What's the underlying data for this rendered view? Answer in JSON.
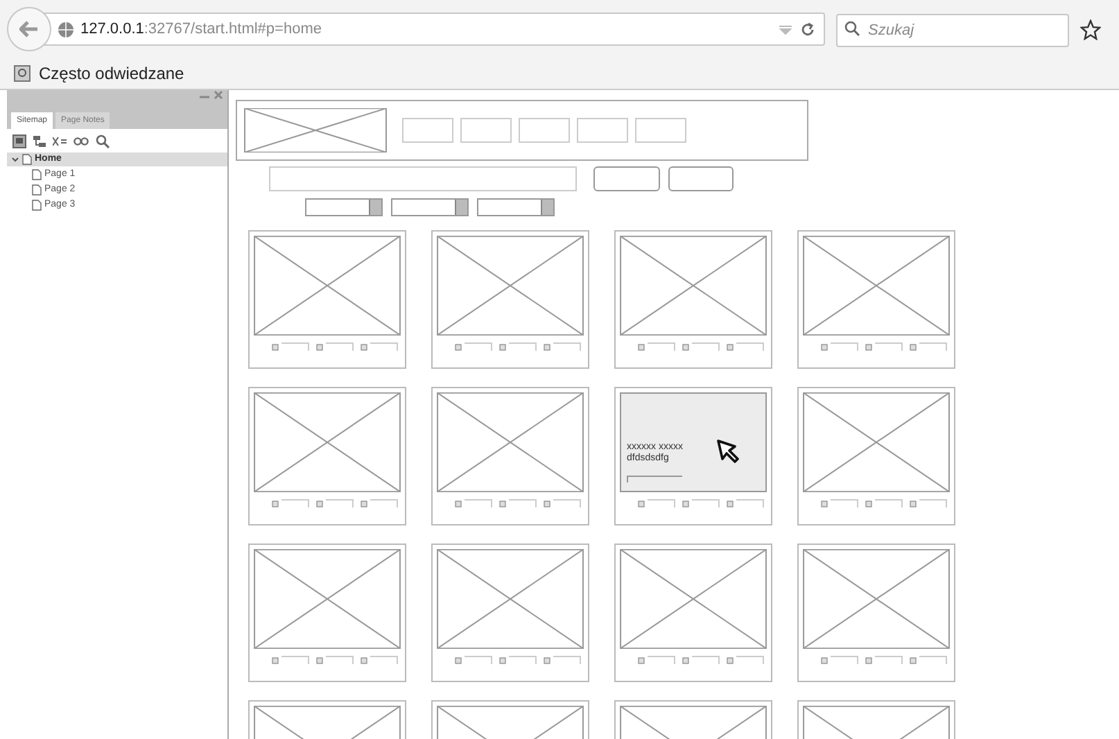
{
  "browser": {
    "url_host": "127.0.0.1",
    "url_path": ":32767/start.html#p=home",
    "search_placeholder": "Szukaj",
    "bookmark": "Często odwiedzane"
  },
  "sidebar": {
    "tabs": [
      {
        "label": "Sitemap",
        "selected": true
      },
      {
        "label": "Page Notes",
        "selected": false
      }
    ],
    "tree": [
      {
        "label": "Home",
        "expanded": true,
        "selected": true,
        "children": [
          {
            "label": "Page 1",
            "selected": false
          },
          {
            "label": "Page 2",
            "selected": false
          },
          {
            "label": "Page 3",
            "selected": false
          }
        ]
      }
    ]
  },
  "cards": [
    {
      "kind": "image"
    },
    {
      "kind": "image"
    },
    {
      "kind": "image"
    },
    {
      "kind": "image"
    },
    {
      "kind": "image"
    },
    {
      "kind": "image"
    },
    {
      "kind": "hover",
      "title": "xxxxxx xxxxx",
      "subtitle": "dfdsdsdfg"
    },
    {
      "kind": "image"
    },
    {
      "kind": "image"
    },
    {
      "kind": "image"
    },
    {
      "kind": "image"
    },
    {
      "kind": "image"
    },
    {
      "kind": "image_cut"
    },
    {
      "kind": "image_cut"
    },
    {
      "kind": "image_cut"
    },
    {
      "kind": "image_cut"
    }
  ]
}
